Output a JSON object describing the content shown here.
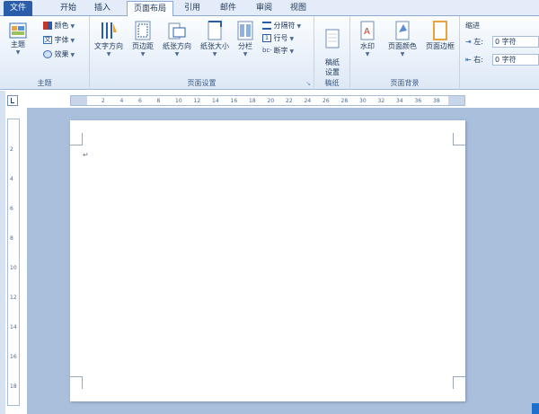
{
  "tabs": [
    {
      "label": "文件"
    },
    {
      "label": "开始"
    },
    {
      "label": "插入"
    },
    {
      "label": "页面布局"
    },
    {
      "label": "引用"
    },
    {
      "label": "邮件"
    },
    {
      "label": "审阅"
    },
    {
      "label": "视图"
    }
  ],
  "themes_group": {
    "label": "主题",
    "theme_button": "主题",
    "colors": "颜色",
    "fonts": "字体",
    "effects": "效果"
  },
  "page_setup_group": {
    "label": "页面设置",
    "text_direction": "文字方向",
    "margins": "页边距",
    "orientation": "纸张方向",
    "size": "纸张大小",
    "columns": "分栏",
    "breaks": "分隔符",
    "line_numbers": "行号",
    "hyphenation": "断字"
  },
  "draft_group": {
    "label": "稿纸",
    "button": "稿纸\n设置"
  },
  "background_group": {
    "label": "页面背景",
    "watermark": "水印",
    "page_color": "页面颜色",
    "page_borders": "页面边框"
  },
  "indent_group": {
    "label": "缩进",
    "left_label": "左:",
    "left_value": "0 字符",
    "right_label": "右:",
    "right_value": "0 字符"
  },
  "ruler": {
    "ticks": [
      "2",
      "4",
      "6",
      "8",
      "10",
      "12",
      "14",
      "16",
      "18",
      "20",
      "22",
      "24",
      "26",
      "28",
      "30",
      "32",
      "34",
      "36",
      "38"
    ]
  },
  "vruler": {
    "ticks": [
      "2",
      "4",
      "6",
      "8",
      "10",
      "12",
      "14",
      "16",
      "18"
    ]
  },
  "colors": {
    "accent": "#2a5ca9",
    "ribbon_bg": "#dde8f6",
    "canvas": "#a9bfdb"
  }
}
